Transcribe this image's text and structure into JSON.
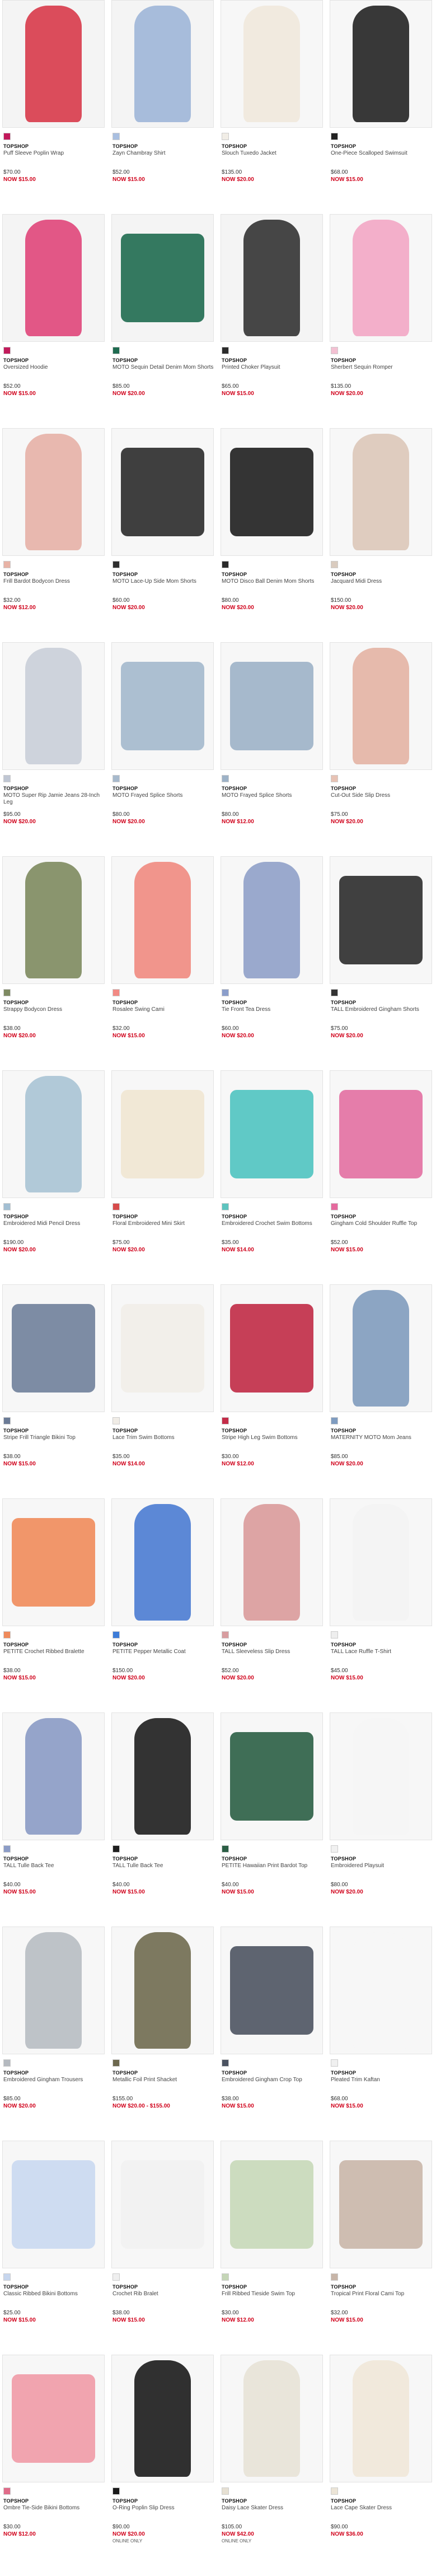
{
  "products": [
    {
      "brand": "TOPSHOP",
      "name": "Puff Sleeve Poplin Wrap",
      "price": "$70.00",
      "sale": "NOW $15.00",
      "img": "#d83a4a",
      "bg": "#f4f4f4",
      "swatch": "#c2185b"
    },
    {
      "brand": "TOPSHOP",
      "name": "Zayn Chambray Shirt",
      "price": "$52.00",
      "sale": "NOW $15.00",
      "img": "#9fb6d8",
      "bg": "#f4f4f4",
      "swatch": "#a9bfe0"
    },
    {
      "brand": "TOPSHOP",
      "name": "Slouch Tuxedo Jacket",
      "price": "$135.00",
      "sale": "NOW $20.00",
      "img": "#efe8dc",
      "bg": "#f7f7f7",
      "swatch": "#f1ede6"
    },
    {
      "brand": "TOPSHOP",
      "name": "One-Piece Scalloped Swimsuit",
      "price": "$68.00",
      "sale": "NOW $15.00",
      "img": "#222222",
      "bg": "#f7f7f7",
      "swatch": "#222222"
    },
    {
      "brand": "TOPSHOP",
      "name": "Oversized Hoodie",
      "price": "$52.00",
      "sale": "NOW $15.00",
      "img": "#e0467a",
      "bg": "#f4f4f4",
      "swatch": "#c21b5b"
    },
    {
      "brand": "TOPSHOP",
      "name": "MOTO Sequin Detail Denim Mom Shorts",
      "price": "$85.00",
      "sale": "NOW $20.00",
      "img": "#1f6b50",
      "bg": "#f4f4f4",
      "swatch": "#1f6b50"
    },
    {
      "brand": "TOPSHOP",
      "name": "Printed Choker Playsuit",
      "price": "$65.00",
      "sale": "NOW $15.00",
      "img": "#333333",
      "bg": "#f4f4f4",
      "swatch": "#2b2b2b"
    },
    {
      "brand": "TOPSHOP",
      "name": "Sherbert Sequin Romper",
      "price": "$135.00",
      "sale": "NOW $20.00",
      "img": "#f2a6c4",
      "bg": "#f7f7f7",
      "swatch": "#f3c1d3"
    },
    {
      "brand": "TOPSHOP",
      "name": "Frill Bardot Bodycon Dress",
      "price": "$32.00",
      "sale": "NOW $12.00",
      "img": "#e5b0a6",
      "bg": "#f7f7f7",
      "swatch": "#e8b3a6"
    },
    {
      "brand": "TOPSHOP",
      "name": "MOTO Lace-Up Side Mom Shorts",
      "price": "$60.00",
      "sale": "NOW $20.00",
      "img": "#2a2a2a",
      "bg": "#f7f7f7",
      "swatch": "#2e2e2e"
    },
    {
      "brand": "TOPSHOP",
      "name": "MOTO Disco Ball Denim Mom Shorts",
      "price": "$80.00",
      "sale": "NOW $20.00",
      "img": "#1e1e1e",
      "bg": "#f7f7f7",
      "swatch": "#2a2a2a"
    },
    {
      "brand": "TOPSHOP",
      "name": "Jacquard Midi Dress",
      "price": "$150.00",
      "sale": "NOW $20.00",
      "img": "#dcc7b8",
      "bg": "#f7f7f7",
      "swatch": "#d9cbbf"
    },
    {
      "brand": "TOPSHOP",
      "name": "MOTO Super Rip Jamie Jeans 28-Inch Leg",
      "price": "$95.00",
      "sale": "NOW $20.00",
      "img": "#c9ced8",
      "bg": "#f7f7f7",
      "swatch": "#bfc6d3"
    },
    {
      "brand": "TOPSHOP",
      "name": "MOTO Frayed Splice Shorts",
      "price": "$80.00",
      "sale": "NOW $20.00",
      "img": "#a3b8cc",
      "bg": "#f7f7f7",
      "swatch": "#a7b9cc"
    },
    {
      "brand": "TOPSHOP",
      "name": "MOTO Frayed Splice Shorts",
      "price": "$80.00",
      "sale": "NOW $12.00",
      "img": "#9cb1c6",
      "bg": "#f7f7f7",
      "swatch": "#9db2c7"
    },
    {
      "brand": "TOPSHOP",
      "name": "Cut-Out Side Slip Dress",
      "price": "$75.00",
      "sale": "NOW $20.00",
      "img": "#e3b3a3",
      "bg": "#f7f7f7",
      "swatch": "#e7c2b4"
    },
    {
      "brand": "TOPSHOP",
      "name": "Strappy Bodycon Dress",
      "price": "$38.00",
      "sale": "NOW $20.00",
      "img": "#7d8a5e",
      "bg": "#f7f7f7",
      "swatch": "#7e8a62"
    },
    {
      "brand": "TOPSHOP",
      "name": "Rosalee Swing Cami",
      "price": "$32.00",
      "sale": "NOW $15.00",
      "img": "#f08a80",
      "bg": "#f7f7f7",
      "swatch": "#f28a84"
    },
    {
      "brand": "TOPSHOP",
      "name": "Tie Front Tea Dress",
      "price": "$60.00",
      "sale": "NOW $20.00",
      "img": "#8fa0c8",
      "bg": "#f7f7f7",
      "swatch": "#8b9ecb"
    },
    {
      "brand": "TOPSHOP",
      "name": "TALL Embroidered Gingham Shorts",
      "price": "$75.00",
      "sale": "NOW $20.00",
      "img": "#2b2b2b",
      "bg": "#f7f7f7",
      "swatch": "#333333"
    },
    {
      "brand": "TOPSHOP",
      "name": "Embroidered Midi Pencil Dress",
      "price": "$190.00",
      "sale": "NOW $20.00",
      "img": "#a8c3d4",
      "bg": "#f7f7f7",
      "swatch": "#a2bfd3"
    },
    {
      "brand": "TOPSHOP",
      "name": "Floral Embroidered Mini Skirt",
      "price": "$75.00",
      "sale": "NOW $20.00",
      "img": "#efe6d2",
      "bg": "#f7f7f7",
      "swatch": "#d74b4b"
    },
    {
      "brand": "TOPSHOP",
      "name": "Embroidered Crochet Swim Bottoms",
      "price": "$35.00",
      "sale": "NOW $14.00",
      "img": "#4fc3c0",
      "bg": "#f7f7f7",
      "swatch": "#5dc4bf"
    },
    {
      "brand": "TOPSHOP",
      "name": "Gingham Cold Shoulder Ruffle Top",
      "price": "$52.00",
      "sale": "NOW $15.00",
      "img": "#e26fa1",
      "bg": "#f7f7f7",
      "swatch": "#e56a9e"
    },
    {
      "brand": "TOPSHOP",
      "name": "Stripe Frill Triangle Bikini Top",
      "price": "$38.00",
      "sale": "NOW $15.00",
      "img": "#6f7f9a",
      "bg": "#f7f7f7",
      "swatch": "#6b7b96"
    },
    {
      "brand": "TOPSHOP",
      "name": "Lace Trim Swim Bottoms",
      "price": "$35.00",
      "sale": "NOW $14.00",
      "img": "#f1ede8",
      "bg": "#f7f7f7",
      "swatch": "#f0ece6"
    },
    {
      "brand": "TOPSHOP",
      "name": "Stripe High Leg Swim Bottoms",
      "price": "$30.00",
      "sale": "NOW $12.00",
      "img": "#c02a45",
      "bg": "#f7f7f7",
      "swatch": "#c42c48"
    },
    {
      "brand": "TOPSHOP",
      "name": "MATERNITY MOTO Mom Jeans",
      "price": "$85.00",
      "sale": "NOW $20.00",
      "img": "#7f9bbd",
      "bg": "#f7f7f7",
      "swatch": "#7f9cc0"
    },
    {
      "brand": "TOPSHOP",
      "name": "PETITE Crochet Ribbed Bralette",
      "price": "$38.00",
      "sale": "NOW $15.00",
      "img": "#f08b5a",
      "bg": "#f7f7f7",
      "swatch": "#ef8a5b"
    },
    {
      "brand": "TOPSHOP",
      "name": "PETITE Pepper Metallic Coat",
      "price": "$150.00",
      "sale": "NOW $20.00",
      "img": "#4a7bd1",
      "bg": "#f7f7f7",
      "swatch": "#3d7cd8"
    },
    {
      "brand": "TOPSHOP",
      "name": "TALL Sleeveless Slip Dress",
      "price": "$52.00",
      "sale": "NOW $20.00",
      "img": "#d99a9a",
      "bg": "#f7f7f7",
      "swatch": "#d89da0"
    },
    {
      "brand": "TOPSHOP",
      "name": "TALL Lace Ruffle T-Shirt",
      "price": "$45.00",
      "sale": "NOW $15.00",
      "img": "#f3f3f3",
      "bg": "#f7f7f7",
      "swatch": "#eeeeee"
    },
    {
      "brand": "TOPSHOP",
      "name": "TALL Tulle Back Tee",
      "price": "$40.00",
      "sale": "NOW $15.00",
      "img": "#8a9ac4",
      "bg": "#f7f7f7",
      "swatch": "#8c9cc7"
    },
    {
      "brand": "TOPSHOP",
      "name": "TALL Tulle Back Tee",
      "price": "$40.00",
      "sale": "NOW $15.00",
      "img": "#1d1d1d",
      "bg": "#f7f7f7",
      "swatch": "#1e1e1e"
    },
    {
      "brand": "TOPSHOP",
      "name": "PETITE Hawaiian Print Bardot Top",
      "price": "$40.00",
      "sale": "NOW $15.00",
      "img": "#2a5e44",
      "bg": "#f7f7f7",
      "swatch": "#2b5e45"
    },
    {
      "brand": "TOPSHOP",
      "name": "Embroidered Playsuit",
      "price": "$80.00",
      "sale": "NOW $20.00",
      "img": "#f5f5f5",
      "bg": "#f7f7f7",
      "swatch": "#f1f1f1"
    },
    {
      "brand": "TOPSHOP",
      "name": "Embroidered Gingham Trousers",
      "price": "$85.00",
      "sale": "NOW $20.00",
      "img": "#b7bcc2",
      "bg": "#f7f7f7",
      "swatch": "#b5bac0"
    },
    {
      "brand": "TOPSHOP",
      "name": "Metallic Foil Print Shacket",
      "price": "$155.00",
      "sale": "NOW $20.00 - $155.00",
      "img": "#6f6a4f",
      "bg": "#f7f7f7",
      "swatch": "#6c684e"
    },
    {
      "brand": "TOPSHOP",
      "name": "Embroidered Gingham Crop Top",
      "price": "$38.00",
      "sale": "NOW $15.00",
      "img": "#4c5360",
      "bg": "#f7f7f7",
      "swatch": "#4b5361"
    },
    {
      "brand": "TOPSHOP",
      "name": "Pleated Trim Kaftan",
      "price": "$68.00",
      "sale": "NOW $15.00",
      "img": "#f6f6f6",
      "bg": "#f7f7f7",
      "swatch": "#f0f0f0"
    },
    {
      "brand": "TOPSHOP",
      "name": "Classic Ribbed Bikini Bottoms",
      "price": "$25.00",
      "sale": "NOW $15.00",
      "img": "#c9d8ef",
      "bg": "#f7f7f7",
      "swatch": "#c7d6ee"
    },
    {
      "brand": "TOPSHOP",
      "name": "Crochet Rib Bralet",
      "price": "$38.00",
      "sale": "NOW $15.00",
      "img": "#f1f1f1",
      "bg": "#f7f7f7",
      "swatch": "#efefef"
    },
    {
      "brand": "TOPSHOP",
      "name": "Frill Ribbed Tieside Swim Top",
      "price": "$30.00",
      "sale": "NOW $12.00",
      "img": "#c7d8b8",
      "bg": "#f7f7f7",
      "swatch": "#c5d6b7"
    },
    {
      "brand": "TOPSHOP",
      "name": "Tropical Print Floral Cami Top",
      "price": "$32.00",
      "sale": "NOW $15.00",
      "img": "#c9b6a8",
      "bg": "#f7f7f7",
      "swatch": "#c7b5a8"
    },
    {
      "brand": "TOPSHOP",
      "name": "Ombre Tie-Side Bikini Bottoms",
      "price": "$30.00",
      "sale": "NOW $12.00",
      "img": "#f09aa6",
      "bg": "#f7f7f7",
      "swatch": "#e06b89"
    },
    {
      "brand": "TOPSHOP",
      "name": "O-Ring Poplin Slip Dress",
      "price": "$90.00",
      "sale": "NOW $20.00",
      "note": "ONLINE ONLY",
      "img": "#1a1a1a",
      "bg": "#f7f7f7",
      "swatch": "#1b1b1b"
    },
    {
      "brand": "TOPSHOP",
      "name": "Daisy Lace Skater Dress",
      "price": "$105.00",
      "sale": "NOW $42.00",
      "note": "ONLINE ONLY",
      "img": "#e7e2d6",
      "bg": "#f7f7f7",
      "swatch": "#e6e0d3"
    },
    {
      "brand": "TOPSHOP",
      "name": "Lace Cape Skater Dress",
      "price": "$90.00",
      "sale": "NOW $36.00",
      "img": "#efe7d8",
      "bg": "#f7f7f7",
      "swatch": "#ece5d7"
    }
  ]
}
